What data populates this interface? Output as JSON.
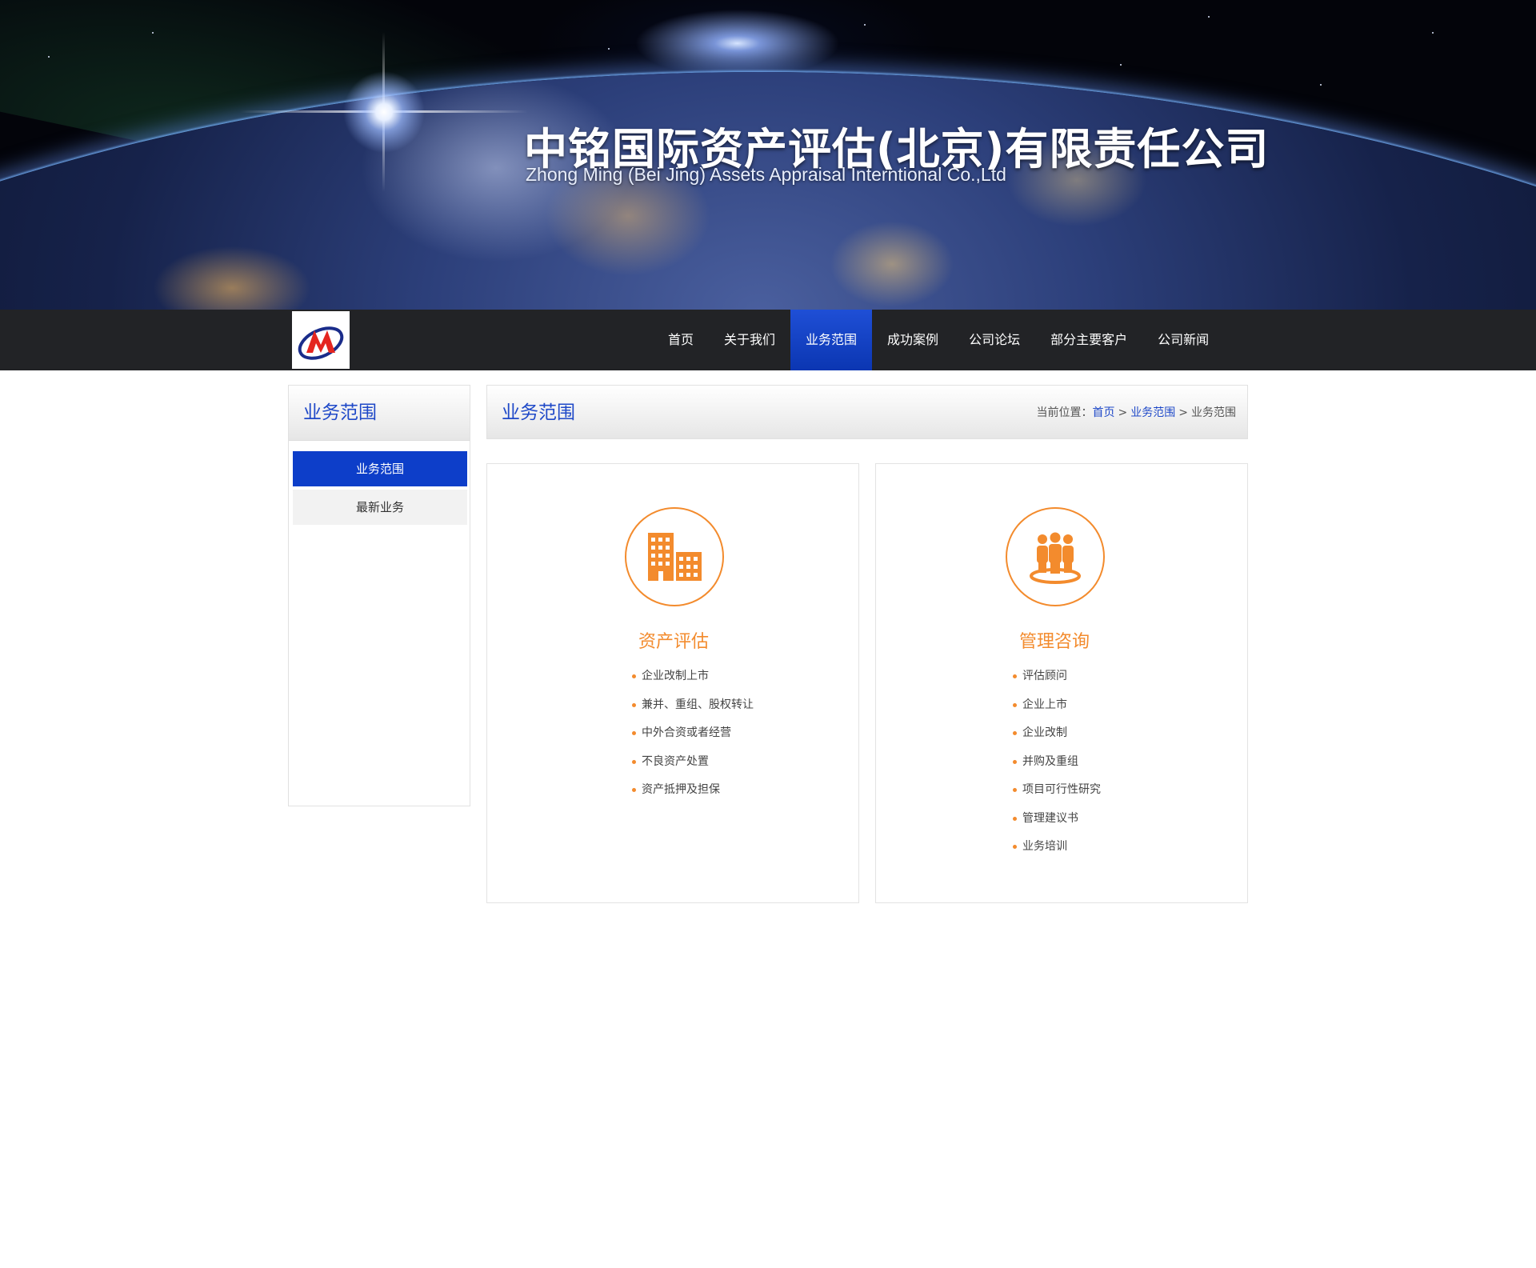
{
  "banner": {
    "title_cn": "中铭国际资产评估(北京)有限责任公司",
    "title_en": "Zhong Ming  (Bei Jing)  Assets Appraisal Interntional Co.,Ltd"
  },
  "nav": {
    "items": [
      "首页",
      "关于我们",
      "业务范围",
      "成功案例",
      "公司论坛",
      "部分主要客户",
      "公司新闻"
    ],
    "active": "业务范围",
    "active_color": "#0b36b2"
  },
  "sidebar": {
    "title": "业务范围",
    "items": [
      "业务范围",
      "最新业务"
    ]
  },
  "content": {
    "title": "业务范围",
    "breadcrumb": {
      "prefix": "当前位置：",
      "items": [
        "首页",
        "业务范围",
        "业务范围"
      ]
    }
  },
  "cards": [
    {
      "icon": "building-icon",
      "title": "资产评估",
      "items": [
        "企业改制上市",
        "兼并、重组、股权转让",
        "中外合资或者经营",
        "不良资产处置",
        "资产抵押及担保"
      ]
    },
    {
      "icon": "team-icon",
      "title": "管理咨询",
      "items": [
        "评估顾问",
        "企业上市",
        "企业改制",
        "并购及重组",
        "项目可行性研究",
        "管理建议书",
        "业务培训"
      ]
    }
  ],
  "colors": {
    "accent_orange": "#f38b2d",
    "brand_blue": "#1f49c8",
    "nav_bg": "#222326"
  }
}
